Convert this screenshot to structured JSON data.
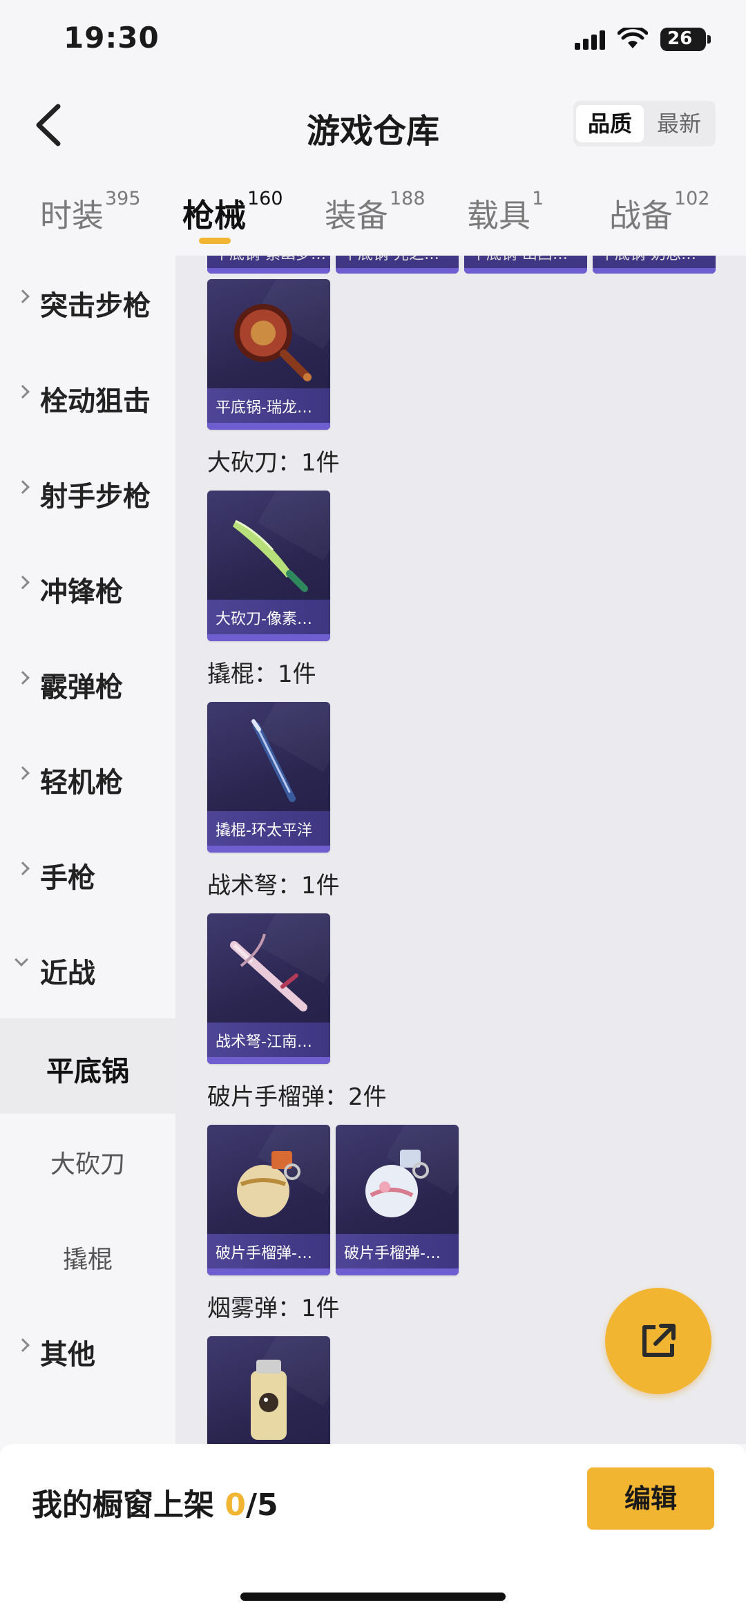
{
  "status_bar": {
    "time": "19:30",
    "battery": "26"
  },
  "header": {
    "title": "游戏仓库",
    "sort_options": [
      "品质",
      "最新"
    ],
    "sort_active": "品质"
  },
  "tabs": [
    {
      "label": "时装",
      "count": "395"
    },
    {
      "label": "枪械",
      "count": "160"
    },
    {
      "label": "装备",
      "count": "188"
    },
    {
      "label": "载具",
      "count": "1"
    },
    {
      "label": "战备",
      "count": "102"
    }
  ],
  "active_tab": "枪械",
  "sidebar": {
    "categories": [
      {
        "label": "突击步枪"
      },
      {
        "label": "栓动狙击"
      },
      {
        "label": "射手步枪"
      },
      {
        "label": "冲锋枪"
      },
      {
        "label": "霰弹枪"
      },
      {
        "label": "轻机枪"
      },
      {
        "label": "手枪"
      },
      {
        "label": "近战"
      }
    ],
    "subcategories": [
      {
        "label": "平底锅"
      },
      {
        "label": "大砍刀"
      },
      {
        "label": "撬棍"
      }
    ],
    "other": {
      "label": "其他"
    }
  },
  "content": {
    "top_partial_items": [
      "平底锅-紫幽梦…",
      "平底锅-光之…",
      "平底锅-山西…",
      "平底锅-奶思…"
    ],
    "groups": [
      {
        "title": "",
        "items": [
          "平底锅-瑞龙…"
        ]
      },
      {
        "title": "大砍刀：1件",
        "items": [
          "大砍刀-像素…"
        ]
      },
      {
        "title": "撬棍：1件",
        "items": [
          "撬棍-环太平洋"
        ]
      },
      {
        "title": "战术弩：1件",
        "items": [
          "战术弩-江南…"
        ]
      },
      {
        "title": "破片手榴弹：2件",
        "items": [
          "破片手榴弹-…",
          "破片手榴弹-…"
        ]
      },
      {
        "title": "烟雾弹：1件",
        "items": [
          ""
        ]
      }
    ]
  },
  "bottom_bar": {
    "shelf_label": "我的橱窗上架 ",
    "shelf_count": "0",
    "shelf_total": "/5",
    "edit_button": "编辑"
  },
  "colors": {
    "accent": "#f2b531",
    "card_bg": "#2a254f",
    "card_caption": "#4e4596"
  }
}
